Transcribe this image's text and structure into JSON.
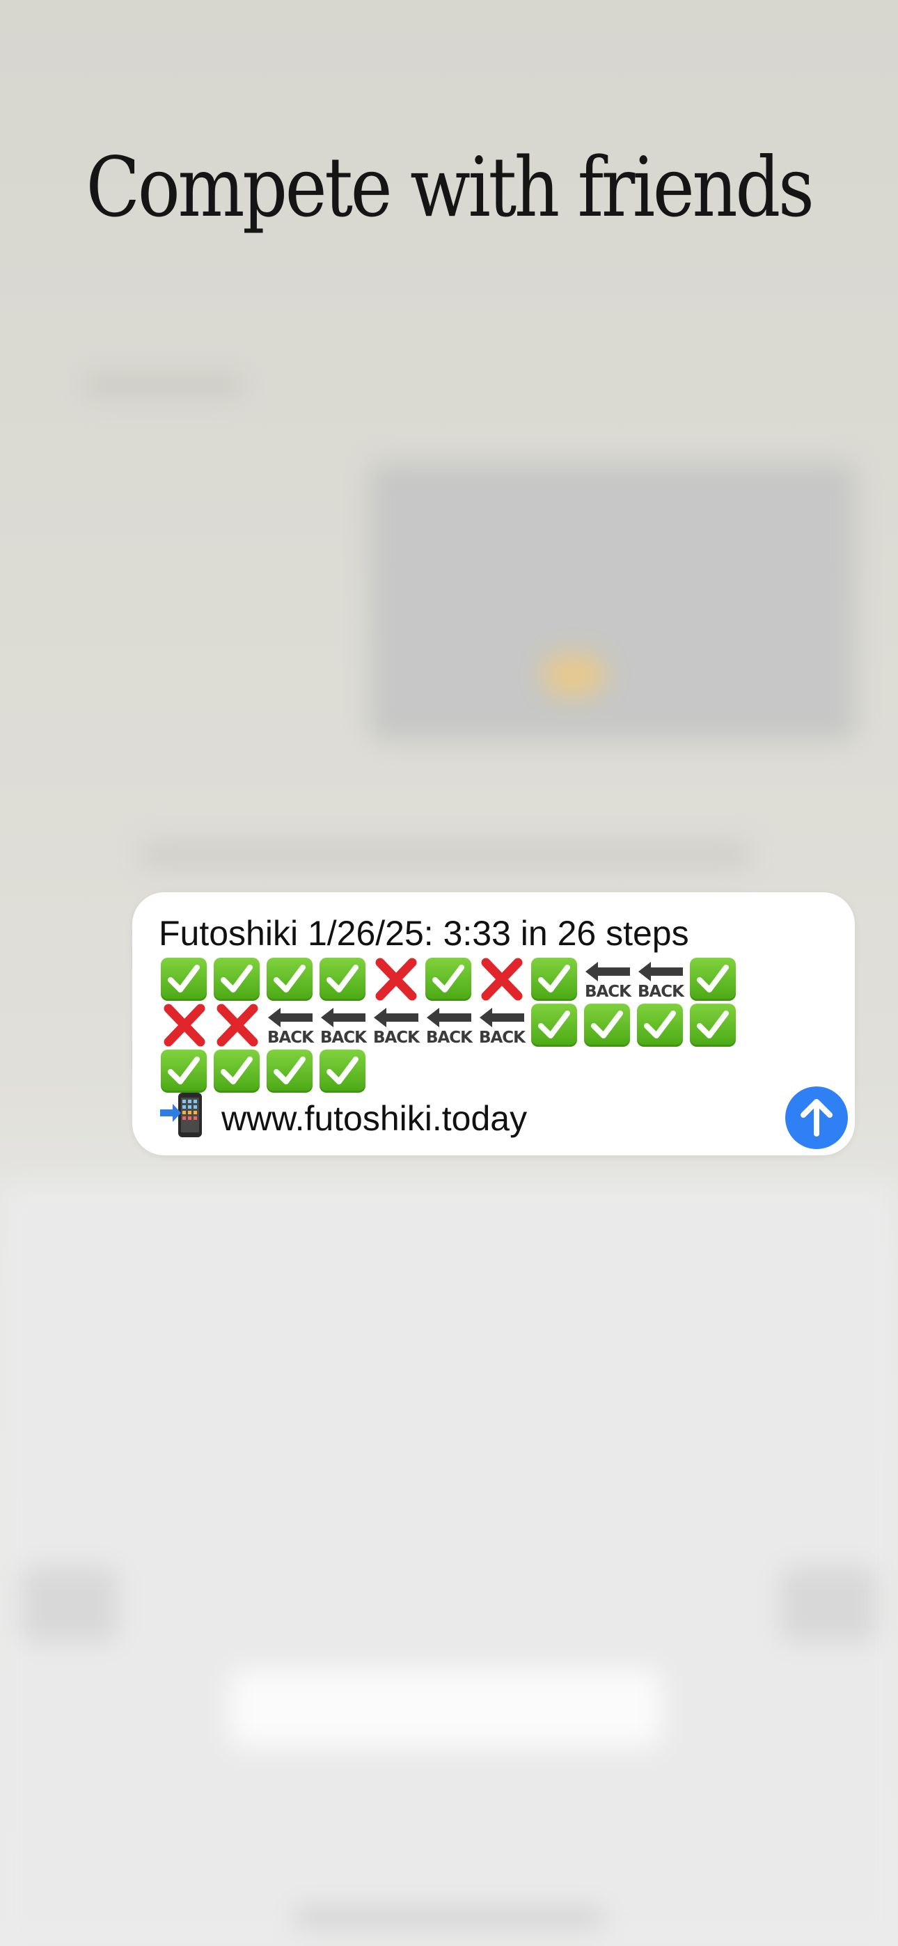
{
  "headline": "Compete with friends",
  "message": {
    "line1": "Futoshiki 1/26/25: 3:33 in 26 steps",
    "rows": [
      [
        "check",
        "check",
        "check",
        "check",
        "cross",
        "check",
        "cross",
        "check",
        "back",
        "back",
        "check"
      ],
      [
        "cross",
        "cross",
        "back",
        "back",
        "back",
        "back",
        "back",
        "check",
        "check",
        "check",
        "check"
      ],
      [
        "check",
        "check",
        "check",
        "check"
      ]
    ],
    "back_label": "BACK",
    "url": "www.futoshiki.today",
    "url_icon": "mobile-phone-arrow-icon"
  },
  "send_button_icon": "arrow-up-icon",
  "colors": {
    "send_button": "#2f80f4",
    "check_green": "#5cb91f",
    "cross_red": "#e0262a",
    "bubble": "#ffffff"
  }
}
